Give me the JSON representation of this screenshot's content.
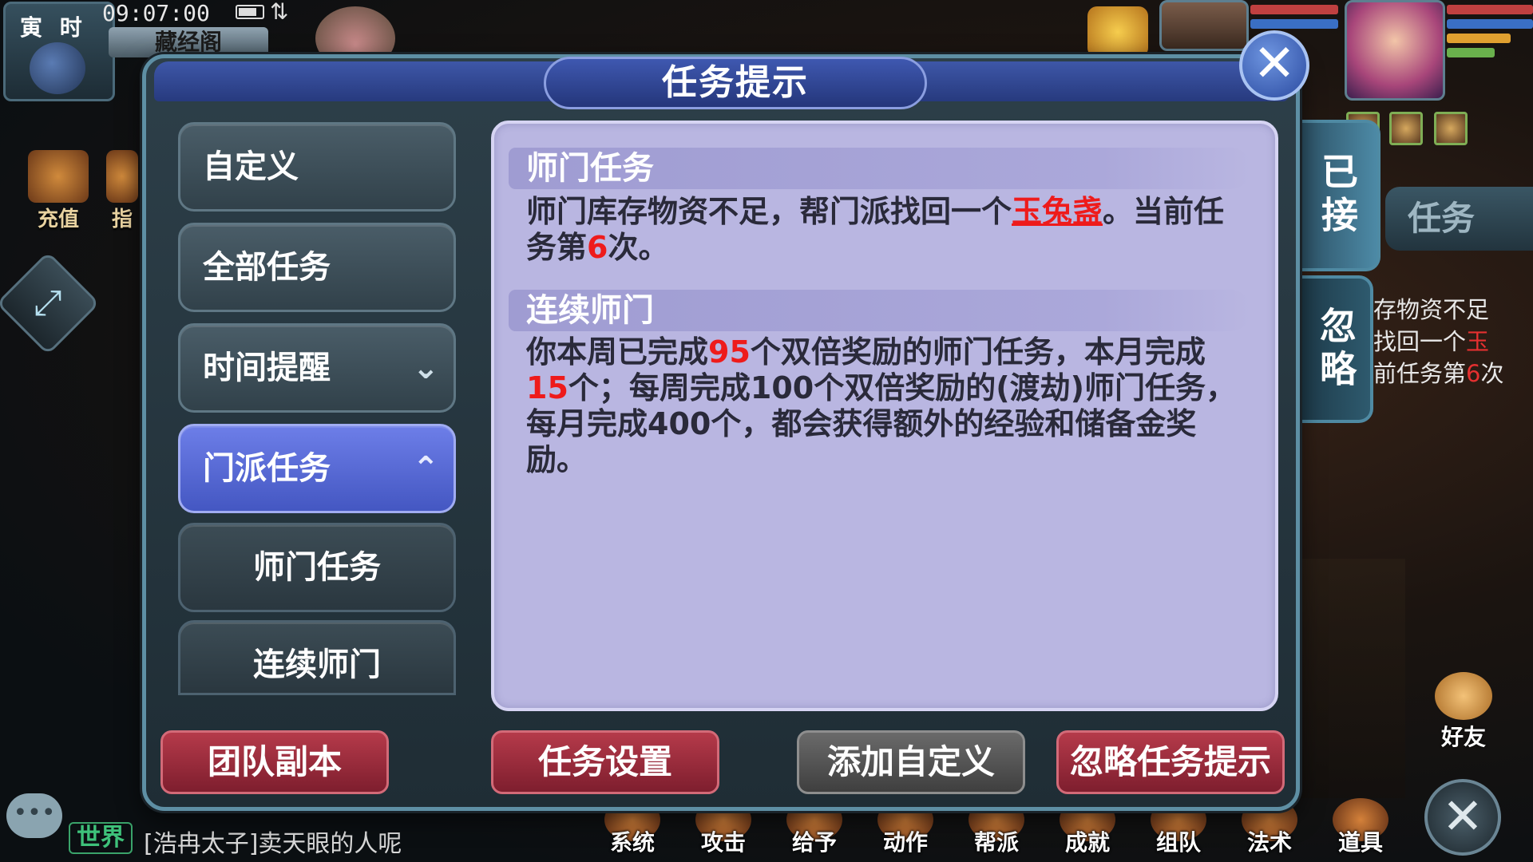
{
  "status": {
    "time_badge_label": "寅 时",
    "clock": "09:07:00",
    "signal": "⇅",
    "location": "藏经阁"
  },
  "left_icons": [
    {
      "label": "充值"
    },
    {
      "label": "指"
    }
  ],
  "dialog": {
    "title": "任务提示",
    "close_icon": "✕",
    "menu": [
      {
        "label": "自定义",
        "active": false
      },
      {
        "label": "全部任务",
        "active": false
      },
      {
        "label": "时间提醒",
        "active": false,
        "chevron": "⌄"
      },
      {
        "label": "门派任务",
        "active": true,
        "chevron": "⌃"
      },
      {
        "label": "师门任务",
        "sub": true
      },
      {
        "label": "连续师门",
        "sub": true
      }
    ],
    "sections": [
      {
        "title": "师门任务",
        "text_1": "师门库存物资不足，帮门派找回一个",
        "link": "玉兔盏",
        "text_2": "。当前任务第",
        "count": "6",
        "text_3": "次。"
      },
      {
        "title": "连续师门",
        "text_1": "你本周已完成",
        "week_count": "95",
        "text_2": "个双倍奖励的师门任务，本月完成",
        "month_count": "15",
        "text_3": "个；每周完成100个双倍奖励的(渡劫)师门任务，每月完成400个，都会获得额外的经验和储备金奖励。"
      }
    ],
    "buttons": {
      "team_dungeon": "团队副本",
      "task_settings": "任务设置",
      "add_custom": "添加自定义",
      "ignore_prompt": "忽略任务提示"
    }
  },
  "side_tabs": {
    "accepted": "已接",
    "ignore": "忽略",
    "task": "任务"
  },
  "tracker": {
    "line_1": "存物资不足",
    "line_2a": "找回一个",
    "line_2b": "玉",
    "line_3a": "前任务第",
    "line_3b": "6",
    "line_3c": "次"
  },
  "chat": {
    "icon": "•••",
    "channel": "世界",
    "message": "[浩冉太子]卖天眼的人呢"
  },
  "bottom_menu": [
    {
      "label": "系统"
    },
    {
      "label": "攻击"
    },
    {
      "label": "给予"
    },
    {
      "label": "动作"
    },
    {
      "label": "帮派"
    },
    {
      "label": "成就"
    },
    {
      "label": "组队"
    },
    {
      "label": "法术"
    },
    {
      "label": "道具"
    }
  ],
  "friend_label": "好友",
  "close_big_icon": "✕",
  "colors": {
    "accent_blue": "#4457c2",
    "button_red": "#7e1e2e",
    "panel_lavender": "#b9b6e1",
    "highlight_red": "#ee1b1b"
  }
}
